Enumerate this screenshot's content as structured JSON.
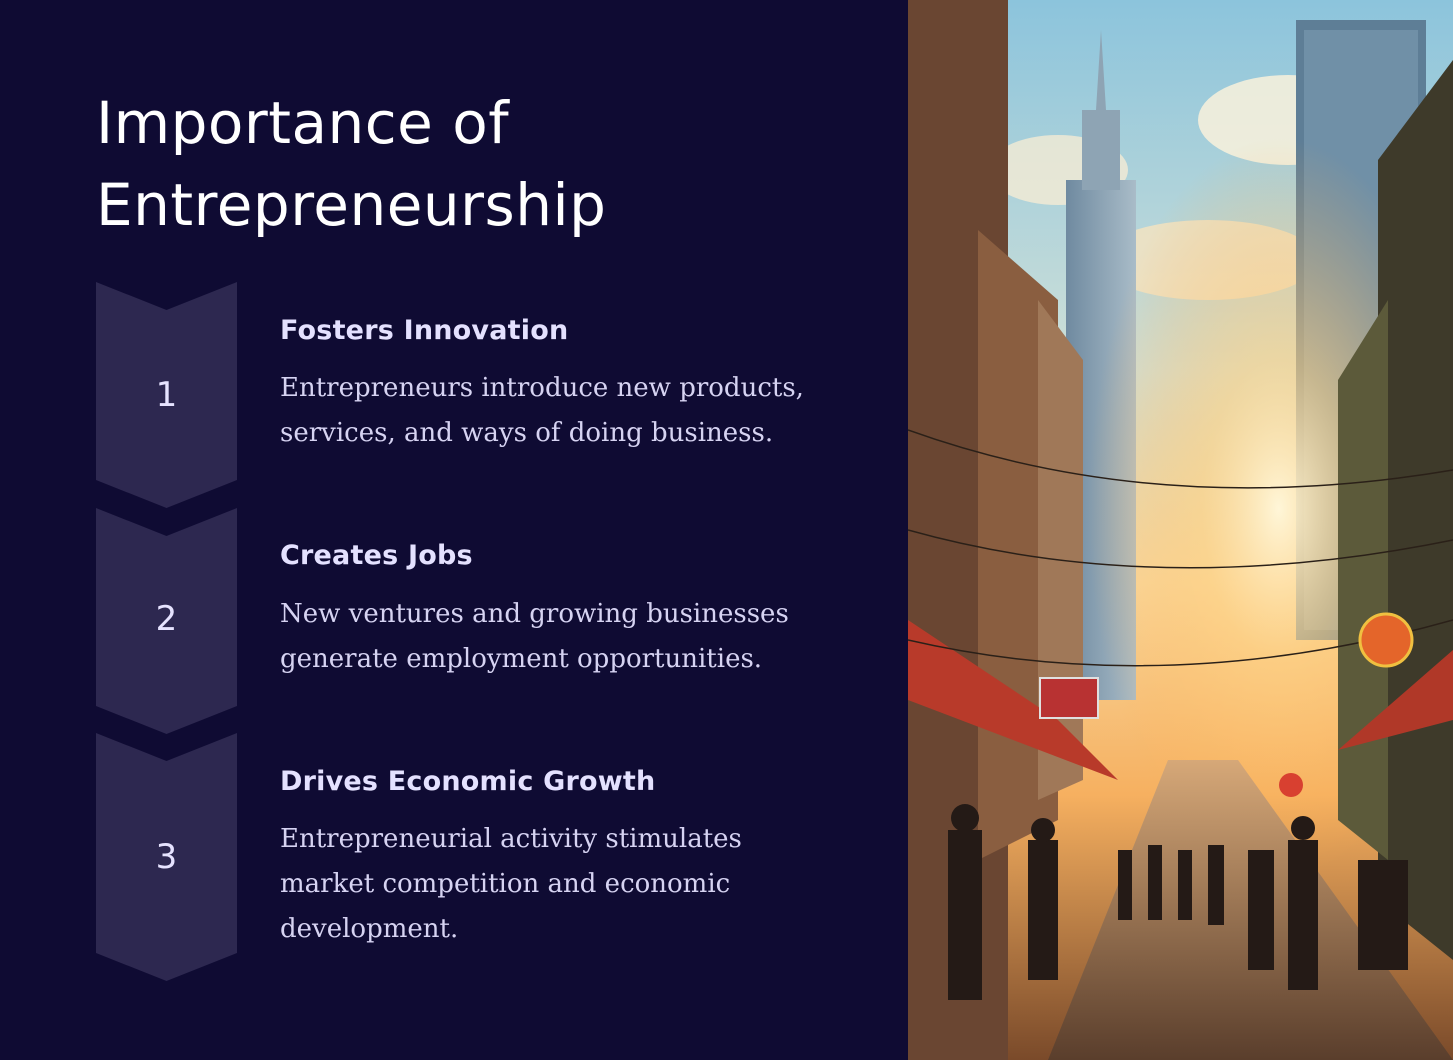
{
  "slide": {
    "title": "Importance of Entrepreneurship",
    "steps": [
      {
        "number": "1",
        "heading": "Fosters Innovation",
        "description": "Entrepreneurs introduce new products, services, and ways of doing business."
      },
      {
        "number": "2",
        "heading": "Creates Jobs",
        "description": "New ventures and growing businesses generate employment opportunities."
      },
      {
        "number": "3",
        "heading": "Drives Economic Growth",
        "description": "Entrepreneurial activity stimulates market competition and economic development."
      }
    ]
  },
  "colors": {
    "background": "#0f0b33",
    "chevron": "#2d2850",
    "heading_text": "#e4e1ff",
    "body_text": "#d6d3f2"
  },
  "photo": {
    "icon": "city-street-photo"
  }
}
